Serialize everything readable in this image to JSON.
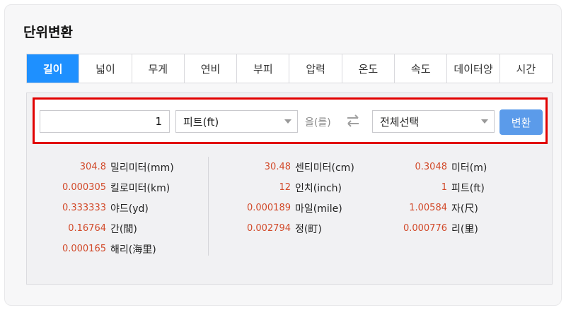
{
  "title": "단위변환",
  "tabs": [
    "길이",
    "넓이",
    "무게",
    "연비",
    "부피",
    "압력",
    "온도",
    "속도",
    "데이터양",
    "시간"
  ],
  "active_tab": 0,
  "converter": {
    "input_value": "1",
    "from_unit": "피트(ft)",
    "particle": "을(를)",
    "to_unit": "전체선택",
    "convert_label": "변환"
  },
  "results": {
    "col1": [
      {
        "value": "304.8",
        "unit": "밀리미터(mm)"
      },
      {
        "value": "0.000305",
        "unit": "킬로미터(km)"
      },
      {
        "value": "0.333333",
        "unit": "야드(yd)"
      },
      {
        "value": "0.16764",
        "unit": "간(間)"
      },
      {
        "value": "0.000165",
        "unit": "해리(海里)"
      }
    ],
    "col2": [
      {
        "value": "30.48",
        "unit": "센티미터(cm)"
      },
      {
        "value": "12",
        "unit": "인치(inch)"
      },
      {
        "value": "0.000189",
        "unit": "마일(mile)"
      },
      {
        "value": "0.002794",
        "unit": "정(町)"
      }
    ],
    "col3": [
      {
        "value": "0.3048",
        "unit": "미터(m)"
      },
      {
        "value": "1",
        "unit": "피트(ft)"
      },
      {
        "value": "1.00584",
        "unit": "자(尺)"
      },
      {
        "value": "0.000776",
        "unit": "리(里)"
      }
    ]
  },
  "colors": {
    "accent": "#1e90ff",
    "button": "#5b9bea",
    "value": "#d24a2a",
    "highlight": "#e10000"
  }
}
